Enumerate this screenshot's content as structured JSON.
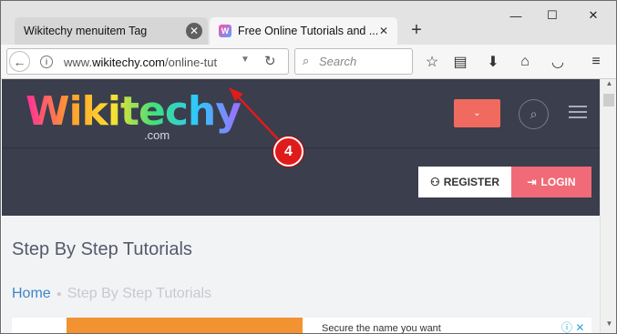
{
  "browser": {
    "tabs": [
      {
        "label": "Wikitechy menuitem Tag",
        "active": false
      },
      {
        "label": "Free Online Tutorials and ...",
        "active": true,
        "favicon": "W"
      }
    ],
    "new_tab_icon": "+",
    "window_controls": {
      "minimize": "—",
      "maximize": "☐",
      "close": "✕"
    },
    "url": {
      "prefix": "www.",
      "domain": "wikitechy.com",
      "path": "/online-tut"
    },
    "search_placeholder": "Search",
    "toolbar_icons": [
      "star-icon",
      "reading-list-icon",
      "download-icon",
      "home-icon",
      "pocket-icon",
      "menu-icon"
    ]
  },
  "site": {
    "logo_text": "Wikitechy",
    "logo_suffix": ".com",
    "register_label": "REGISTER",
    "login_label": "LOGIN",
    "page_title": "Step By Step Tutorials",
    "breadcrumb": {
      "home": "Home",
      "current": "Step By Step Tutorials"
    },
    "ad_text": "Secure the name you want",
    "colors": {
      "header_bg": "#3a3e4d",
      "accent_red": "#f06a5f",
      "login_bg": "#f06a78",
      "link_blue": "#3e86c8"
    }
  },
  "annotation": {
    "badge": "4"
  }
}
